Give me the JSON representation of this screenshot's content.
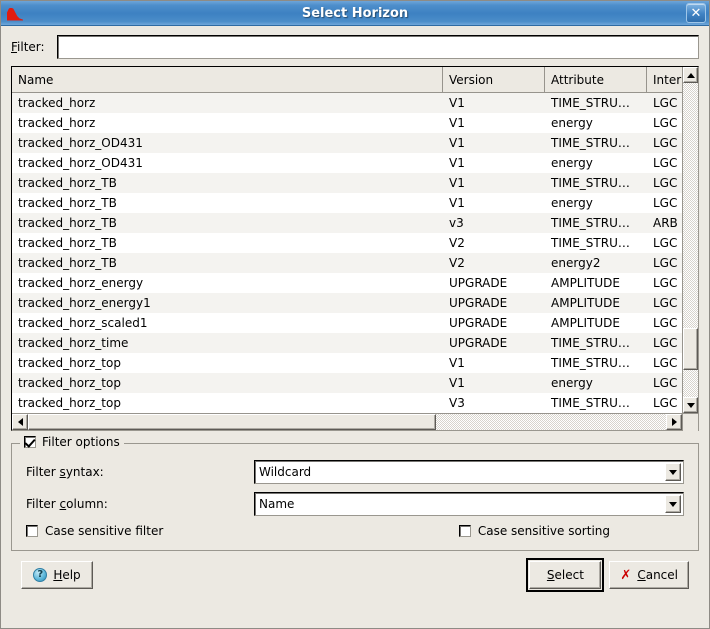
{
  "window": {
    "title": "Select Horizon",
    "icon": "horizon-waveform-icon",
    "close_label": "✕"
  },
  "filter": {
    "label_prefix": "F",
    "label_rest": "ilter:",
    "value": "",
    "placeholder": ""
  },
  "table": {
    "columns": [
      "Name",
      "Version",
      "Attribute",
      "Interp"
    ],
    "rows": [
      {
        "name": "tracked_horz",
        "version": "V1",
        "attribute": "TIME_STRU…",
        "interp": "LGC"
      },
      {
        "name": "tracked_horz",
        "version": "V1",
        "attribute": "energy",
        "interp": "LGC"
      },
      {
        "name": "tracked_horz_OD431",
        "version": "V1",
        "attribute": "TIME_STRU…",
        "interp": "LGC"
      },
      {
        "name": "tracked_horz_OD431",
        "version": "V1",
        "attribute": "energy",
        "interp": "LGC"
      },
      {
        "name": "tracked_horz_TB",
        "version": "V1",
        "attribute": "TIME_STRU…",
        "interp": "LGC"
      },
      {
        "name": "tracked_horz_TB",
        "version": "V1",
        "attribute": "energy",
        "interp": "LGC"
      },
      {
        "name": "tracked_horz_TB",
        "version": "v3",
        "attribute": "TIME_STRU…",
        "interp": "ARB"
      },
      {
        "name": "tracked_horz_TB",
        "version": "V2",
        "attribute": "TIME_STRU…",
        "interp": "LGC"
      },
      {
        "name": "tracked_horz_TB",
        "version": "V2",
        "attribute": "energy2",
        "interp": "LGC"
      },
      {
        "name": "tracked_horz_energy",
        "version": "UPGRADE",
        "attribute": "AMPLITUDE",
        "interp": "LGC"
      },
      {
        "name": "tracked_horz_energy1",
        "version": "UPGRADE",
        "attribute": "AMPLITUDE",
        "interp": "LGC"
      },
      {
        "name": "tracked_horz_scaled1",
        "version": "UPGRADE",
        "attribute": "AMPLITUDE",
        "interp": "LGC"
      },
      {
        "name": "tracked_horz_time",
        "version": "UPGRADE",
        "attribute": "TIME_STRU…",
        "interp": "LGC"
      },
      {
        "name": "tracked_horz_top",
        "version": "V1",
        "attribute": "TIME_STRU…",
        "interp": "LGC"
      },
      {
        "name": "tracked_horz_top",
        "version": "V1",
        "attribute": "energy",
        "interp": "LGC"
      },
      {
        "name": "tracked_horz_top",
        "version": "V3",
        "attribute": "TIME_STRU…",
        "interp": "LGC"
      }
    ]
  },
  "filter_options": {
    "group_label": "Filter options",
    "group_checked": true,
    "syntax": {
      "label_a": "Filter ",
      "label_m": "s",
      "label_b": "yntax:",
      "value": "Wildcard"
    },
    "column": {
      "label_a": "Filter ",
      "label_m": "c",
      "label_b": "olumn:",
      "value": "Name"
    },
    "case_sensitive_filter": {
      "label": "Case sensitive filter",
      "checked": false
    },
    "case_sensitive_sorting": {
      "label": "Case sensitive sorting",
      "checked": false
    }
  },
  "buttons": {
    "help": {
      "mnemonic": "H",
      "rest": "elp",
      "icon": "?"
    },
    "select": {
      "mnemonic": "S",
      "rest": "elect"
    },
    "cancel": {
      "mnemonic": "C",
      "rest": "ancel",
      "icon": "✗"
    }
  }
}
